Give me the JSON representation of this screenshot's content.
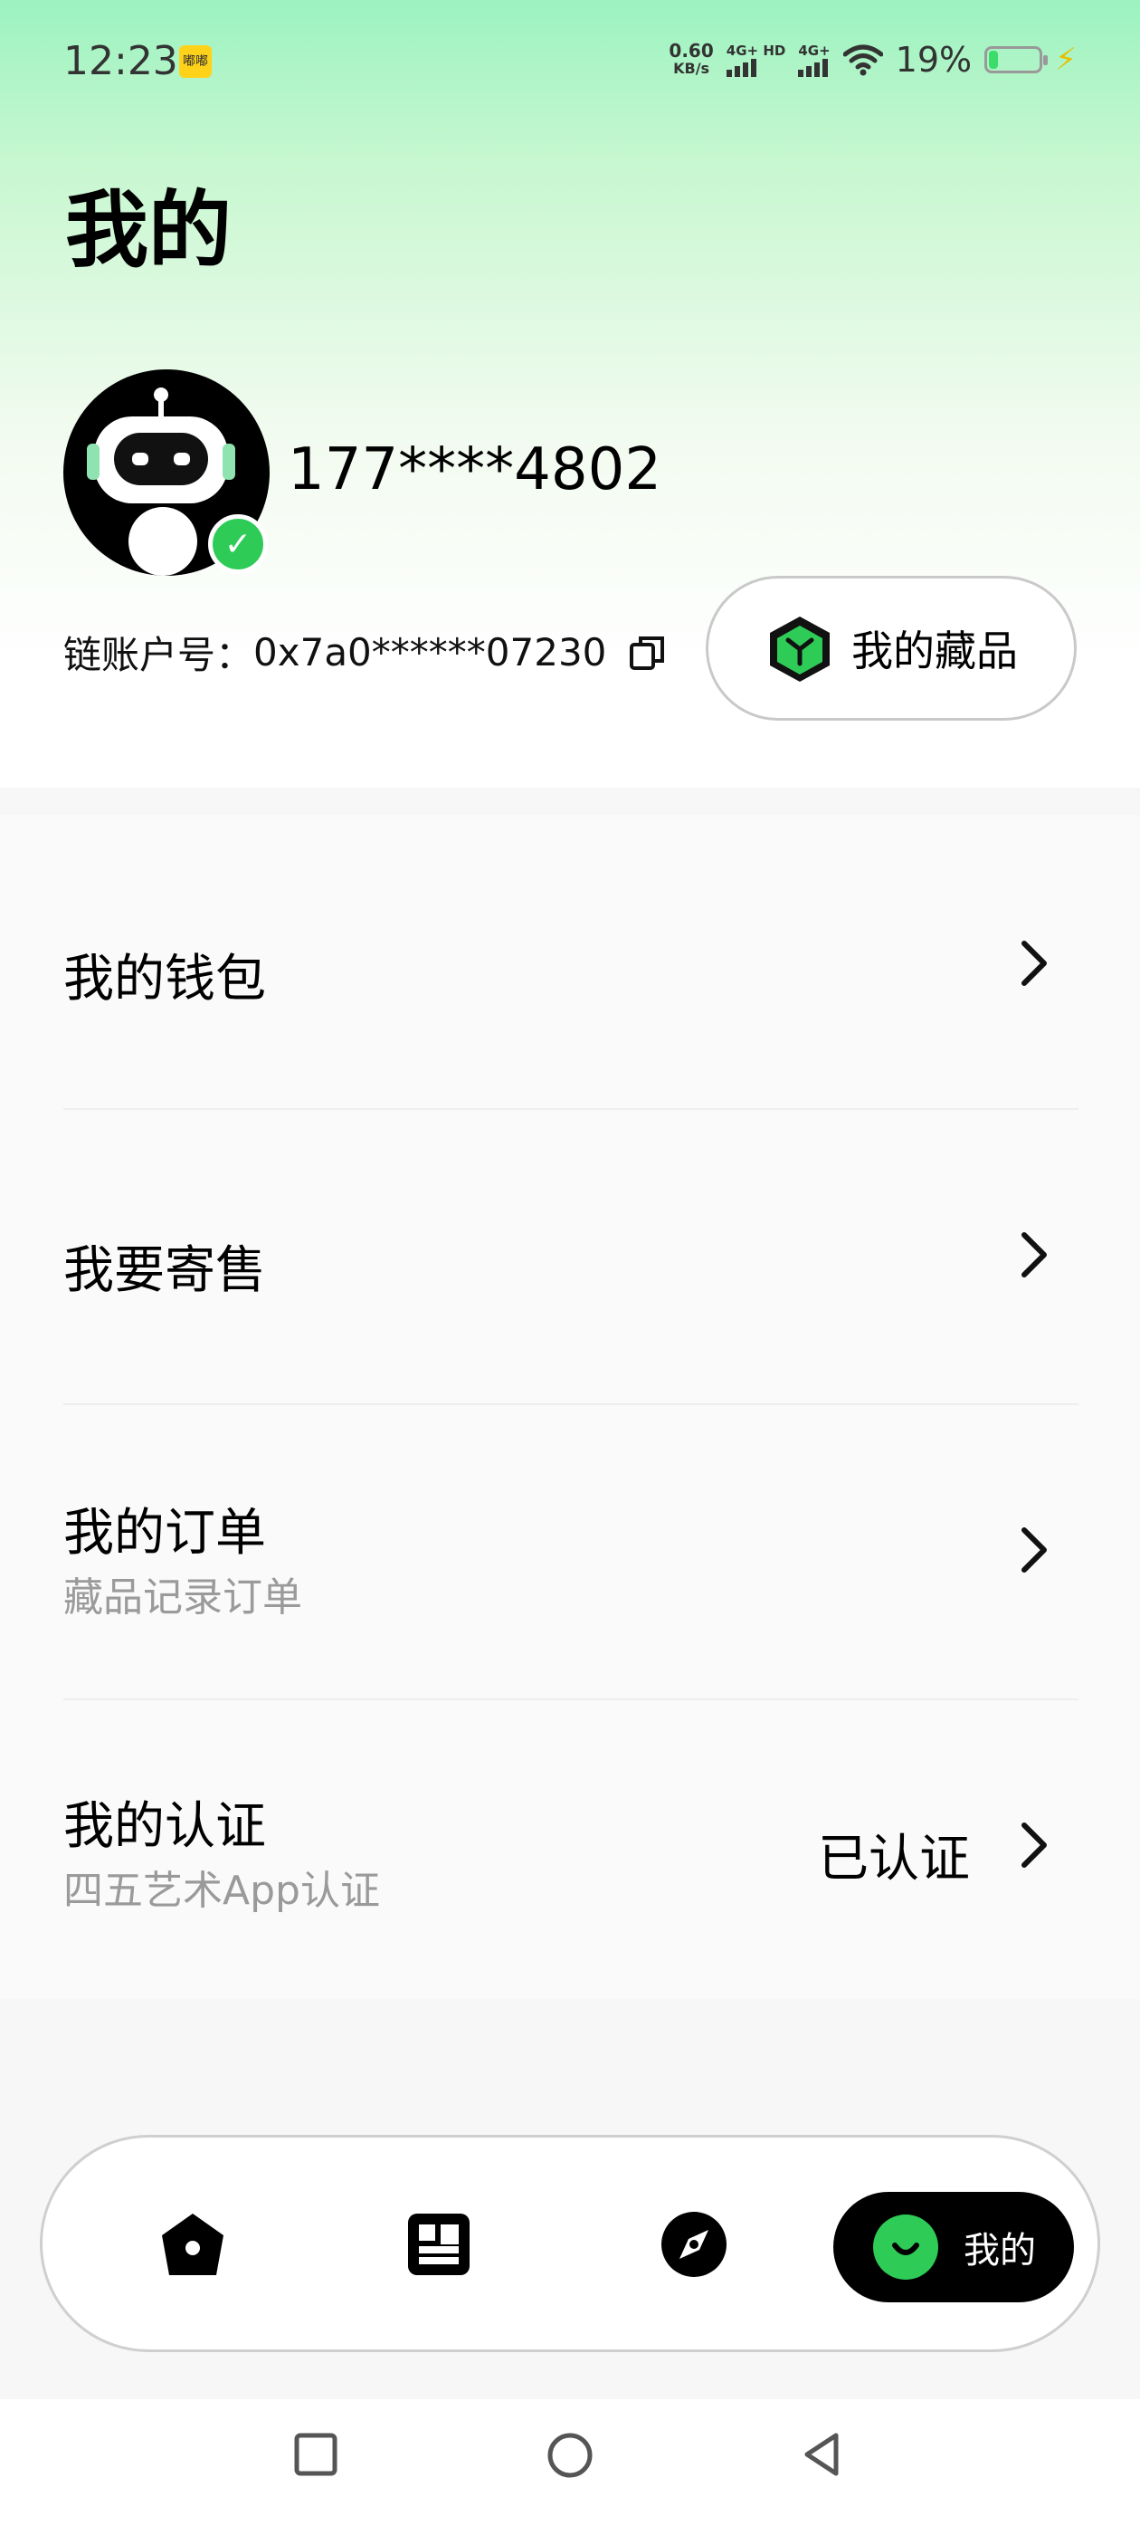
{
  "status_bar": {
    "time": "12:23",
    "app_notification_text": "嘟嘟",
    "net_speed_value": "0.60",
    "net_speed_unit": "KB/s",
    "sim1_label": "4G+ HD",
    "sim2_label": "4G+",
    "battery_percent": "19%",
    "battery_level": 0.19,
    "icons": [
      "wifi-icon",
      "battery-icon",
      "charging-icon"
    ]
  },
  "page": {
    "title": "我的"
  },
  "profile": {
    "username": "177****4802",
    "verified": true,
    "chain_account_label": "链账户号：",
    "chain_account_value": "0x7a0******07230",
    "collection_button": "我的藏品"
  },
  "menu": [
    {
      "title": "我的钱包",
      "subtitle": "",
      "value": ""
    },
    {
      "title": "我要寄售",
      "subtitle": "",
      "value": ""
    },
    {
      "title": "我的订单",
      "subtitle": "藏品记录订单",
      "value": ""
    },
    {
      "title": "我的认证",
      "subtitle": "四五艺术App认证",
      "value": "已认证"
    }
  ],
  "bottom_nav": {
    "items": [
      "home-icon",
      "market-icon",
      "discover-icon"
    ],
    "active_label": "我的"
  },
  "colors": {
    "accent_green": "#2ecc57",
    "header_gradient_top": "#9cf2c0"
  }
}
